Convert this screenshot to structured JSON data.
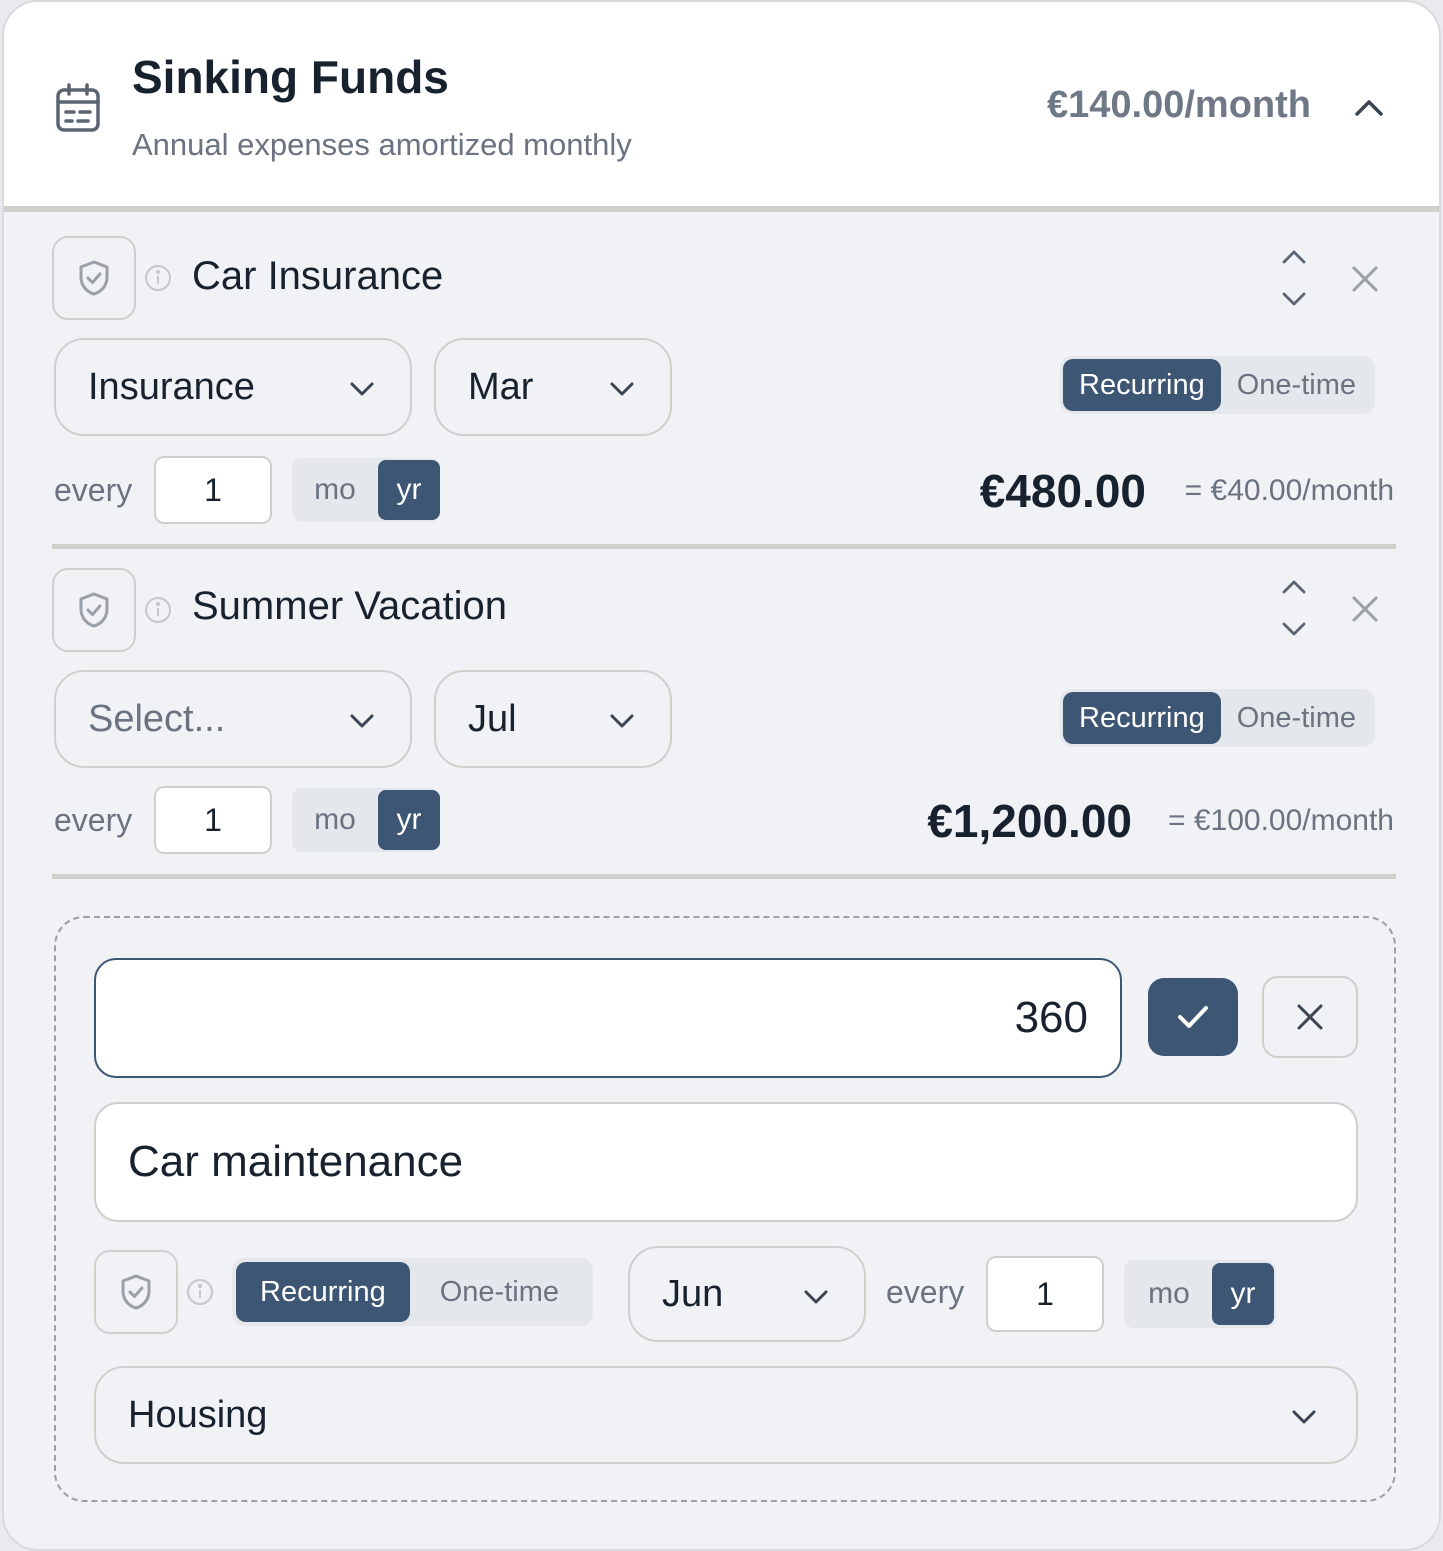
{
  "header": {
    "title": "Sinking Funds",
    "subtitle": "Annual expenses amortized monthly",
    "total": "€140.00/month",
    "icon": "calendar-icon"
  },
  "items": [
    {
      "name": "Car Insurance",
      "category": "Insurance",
      "month": "Mar",
      "type_options": [
        "Recurring",
        "One-time"
      ],
      "type_selected": "Recurring",
      "every_label": "every",
      "interval": "1",
      "units": [
        "mo",
        "yr"
      ],
      "unit_selected": "yr",
      "amount": "€480.00",
      "monthly": "= €40.00/month"
    },
    {
      "name": "Summer Vacation",
      "category": "Select...",
      "month": "Jul",
      "type_options": [
        "Recurring",
        "One-time"
      ],
      "type_selected": "Recurring",
      "every_label": "every",
      "interval": "1",
      "units": [
        "mo",
        "yr"
      ],
      "unit_selected": "yr",
      "amount": "€1,200.00",
      "monthly": "= €100.00/month"
    }
  ],
  "new_item": {
    "amount": "360",
    "name": "Car maintenance",
    "type_options": [
      "Recurring",
      "One-time"
    ],
    "type_selected": "Recurring",
    "month": "Jun",
    "every_label": "every",
    "interval": "1",
    "units": [
      "mo",
      "yr"
    ],
    "unit_selected": "yr",
    "category": "Housing"
  },
  "colors": {
    "accent": "#3d5674",
    "background": "#f0f2f6",
    "border": "#cfd0cc",
    "muted_text": "#6b7280"
  }
}
